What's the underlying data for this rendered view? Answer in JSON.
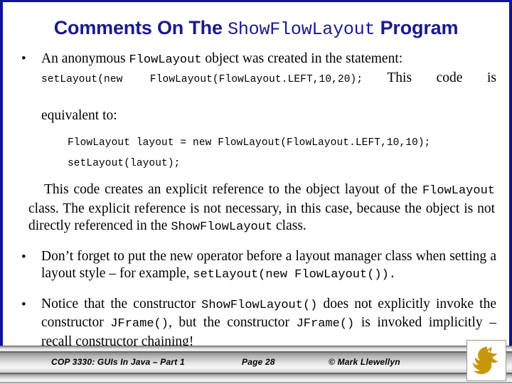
{
  "slide": {
    "title": {
      "pre": "Comments On The ",
      "mono": "ShowFlowLayout",
      "post": " Program",
      "color": "#1a1a8c"
    },
    "bullets": [
      {
        "marker": "•",
        "line1_pre": "An anonymous ",
        "line1_mono": "FlowLayout",
        "line1_post": " object was created in the statement:",
        "statement_code": "setLayout(new  FlowLayout(FlowLayout.LEFT,10,20);",
        "statement_tail": " This code is",
        "line3": "equivalent to:"
      },
      {
        "marker": "•",
        "pre": "Don’t forget to put the new operator before a layout manager class when setting a layout style – for example, ",
        "mono": "setLayout(new FlowLayout()).",
        "post": ""
      },
      {
        "marker": "•",
        "seg1": "Notice that the constructor ",
        "mono1": "ShowFlowLayout()",
        "seg2": " does not explicitly invoke the constructor ",
        "mono2": "JFrame()",
        "seg3": ", but the constructor ",
        "mono3": "JFrame()",
        "seg4": " is invoked implicitly – recall constructor chaining!"
      }
    ],
    "code_block": [
      "FlowLayout layout = new FlowLayout(FlowLayout.LEFT,10,10);",
      "setLayout(layout);"
    ],
    "paragraph": {
      "seg1": "This code creates an explicit reference to the object layout of the ",
      "mono1": "FlowLayout",
      "seg2": " class.  The explicit reference is not necessary, in this case, because the object is not directly referenced in the ",
      "mono2": "ShowFlowLayout",
      "seg3": " class."
    }
  },
  "footer": {
    "course": "COP 3330:  GUIs In Java – Part 1",
    "page": "Page 28",
    "copyright": "© Mark Llewellyn",
    "logo_name": "ucf-pegasus-logo",
    "logo_color": "#c8960c"
  }
}
